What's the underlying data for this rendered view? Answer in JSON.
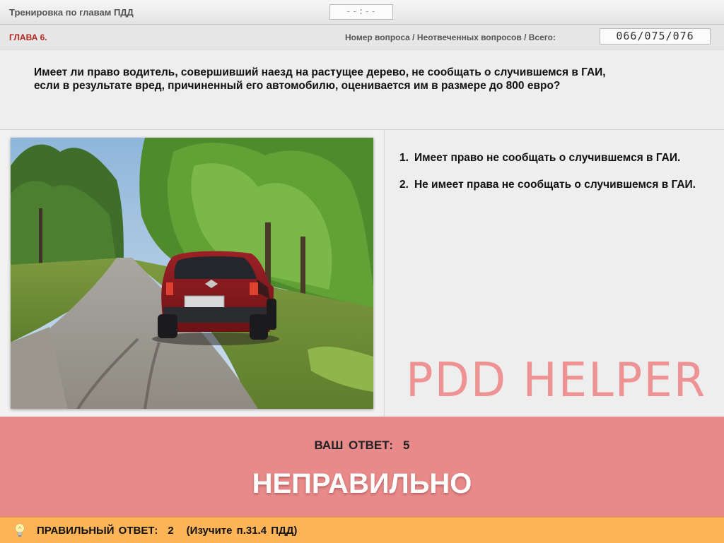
{
  "header": {
    "app_title": "Тренировка по главам ПДД",
    "timer": "--:--"
  },
  "info": {
    "chapter": "ГЛАВА 6.",
    "counter_label": "Номер вопроса / Неотвеченных вопросов / Всего:",
    "counter_value": "066/075/076"
  },
  "question": {
    "text": "Имеет ли право водитель, совершивший наезд на растущее дерево, не сообщать о случившемся в ГАИ, если в результате вред, причиненный его автомобилю, оценивается им в размере до 800 евро?"
  },
  "answers": [
    {
      "num": "1.",
      "text": "Имеет право не сообщать о случившемся в ГАИ."
    },
    {
      "num": "2.",
      "text": "Не имеет права не сообщать о случившемся в ГАИ."
    }
  ],
  "watermark": "PDD HELPER",
  "result": {
    "your_answer_label": "ВАШ ОТВЕТ:",
    "your_answer_value": "5",
    "verdict": "НЕПРАВИЛЬНО"
  },
  "footer": {
    "correct_label": "ПРАВИЛЬНЫЙ ОТВЕТ:",
    "correct_value": "2",
    "hint": "(Изучите п.31.4 ПДД)",
    "icon": "lightbulb-icon"
  },
  "colors": {
    "chapter_red": "#b3261e",
    "result_bg": "#e88a8a",
    "footer_bg": "#fdb558",
    "watermark": "#ef8f8f"
  }
}
